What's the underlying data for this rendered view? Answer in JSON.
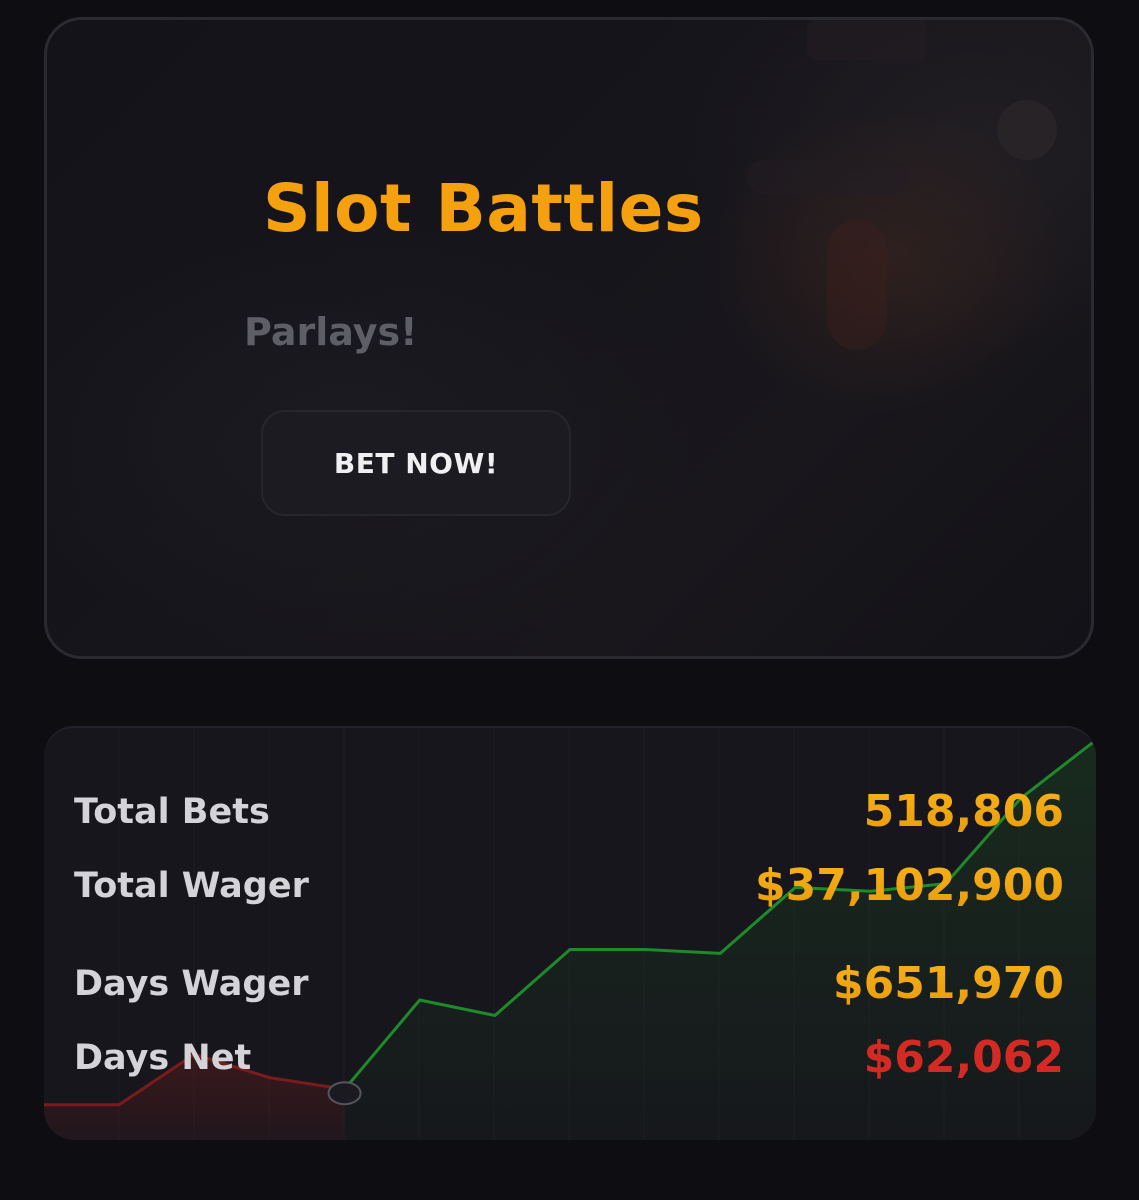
{
  "hero": {
    "title": "Slot Battles",
    "subtitle": "Parlays!",
    "cta_label": "BET NOW!"
  },
  "stats": {
    "rows": [
      {
        "label": "Total Bets",
        "value": "518,806",
        "tone": "gold"
      },
      {
        "label": "Total Wager",
        "value": "$37,102,900",
        "tone": "gold"
      },
      {
        "label": "Days Wager",
        "value": "$651,970",
        "tone": "gold"
      },
      {
        "label": "Days Net",
        "value": "$62,062",
        "tone": "red"
      }
    ]
  },
  "sparkline": {
    "values": [
      0.06,
      0.06,
      0.19,
      0.13,
      0.1,
      0.33,
      0.29,
      0.46,
      0.46,
      0.45,
      0.62,
      0.61,
      0.63,
      0.85,
      1.0
    ],
    "marker_index": 4
  },
  "colors": {
    "accent": "#f5a00f",
    "negative": "#d42a24",
    "positive_line": "#1f8a2a",
    "negative_line": "#7a1c1c",
    "background": "#0d0d12",
    "card": "#16161c"
  }
}
